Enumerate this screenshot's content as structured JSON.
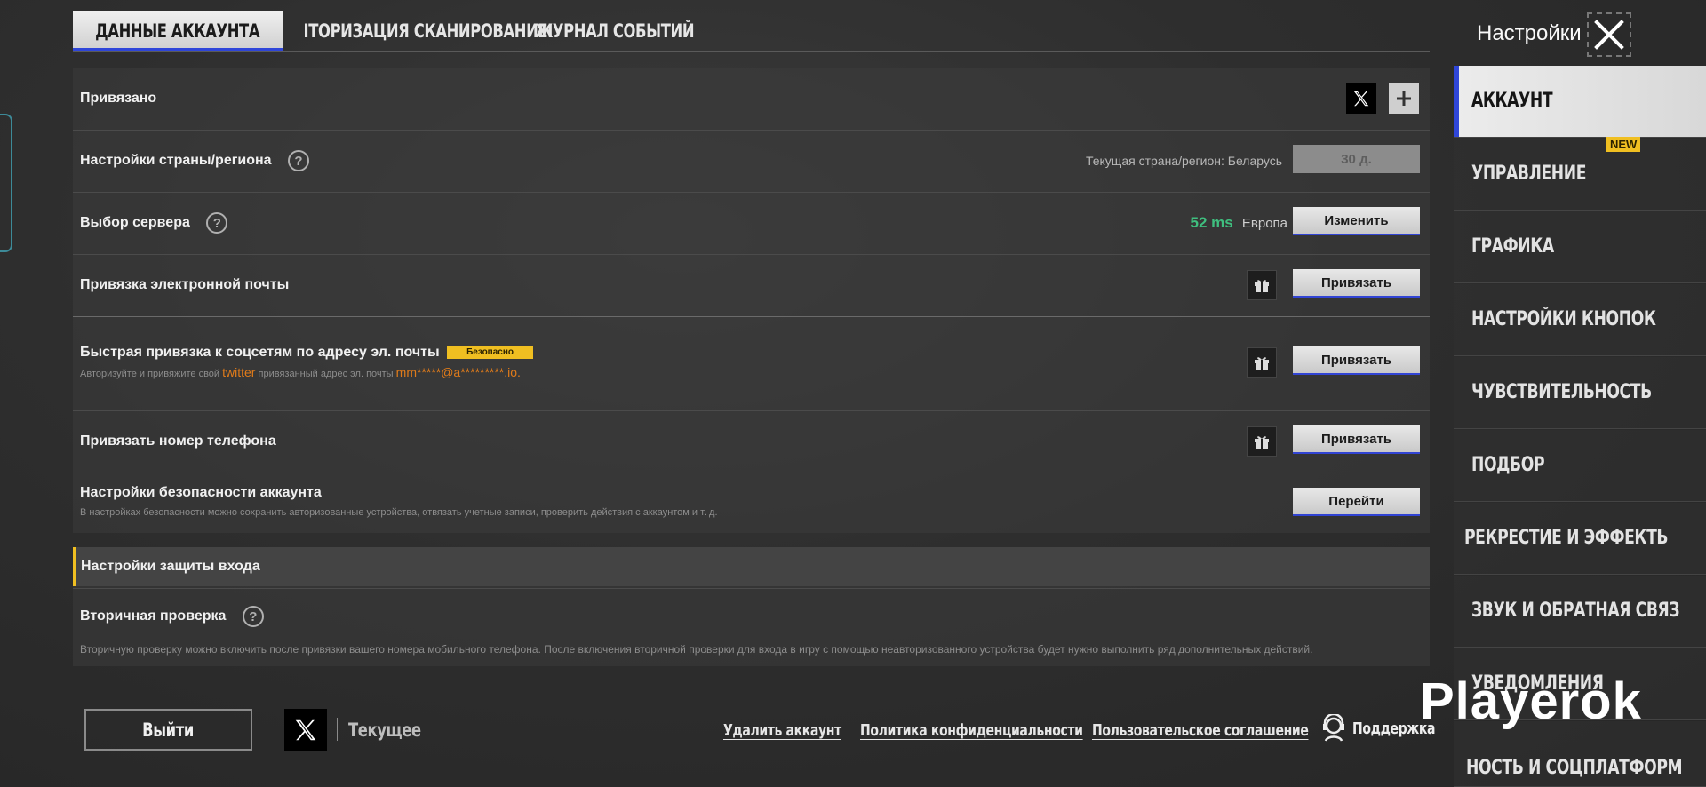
{
  "tabs": [
    {
      "label": "ДАННЫЕ АККАУНТА",
      "active": true
    },
    {
      "label": "ІТОРИЗАЦИЯ СКАНИРОВАНИЕІ",
      "active": false
    },
    {
      "label": "ЖУРНАЛ СОБЫТИЙ",
      "active": false
    }
  ],
  "rows": {
    "linked": {
      "label": "Привязано"
    },
    "region": {
      "label": "Настройки страны/региона",
      "current": "Текущая страна/регион: Беларусь",
      "button": "30 д."
    },
    "server": {
      "label": "Выбор сервера",
      "ping": "52 ms",
      "server_name": "Европа",
      "button": "Изменить"
    },
    "email": {
      "label": "Привязка электронной почты",
      "button": "Привязать"
    },
    "quick_bind": {
      "label": "Быстрая привязка к соцсетям по адресу эл. почты",
      "badge": "Безопасно",
      "sub_prefix": "Авторизуйте и привяжите свой",
      "sub_service": "twitter",
      "sub_middle": "привязанный адрес эл. почты",
      "sub_email": "mm*****@a*********.io.",
      "button": "Привязать"
    },
    "phone": {
      "label": "Привязать номер телефона",
      "button": "Привязать"
    },
    "security": {
      "label": "Настройки безопасности аккаунта",
      "sub": "В настройках безопасности можно сохранить авторизованные устройства, отвязать учетные записи, проверить действия с аккаунтом и т. д.",
      "button": "Перейти"
    }
  },
  "login_protection": {
    "title": "Настройки защиты входа",
    "secondary_label": "Вторичная проверка",
    "secondary_sub": "Вторичную проверку можно включить после привязки вашего номера мобильного телефона. После включения вторичной проверки для входа в игру с помощью неавторизованного устройства будет нужно выполнить ряд дополнительных действий."
  },
  "sidebar": {
    "title": "Настройки",
    "items": [
      {
        "label": "АККАУНТ",
        "active": true
      },
      {
        "label": "УПРАВЛЕНИЕ",
        "badge": "NEW"
      },
      {
        "label": "ГРАФИКА"
      },
      {
        "label": "НАСТРОЙКИ КНОПОК"
      },
      {
        "label": "ЧУВСТВИТЕЛЬНОСТЬ"
      },
      {
        "label": "ПОДБОР"
      },
      {
        "label": "РЕКРЕСТИЕ И ЭФФЕКТЬ"
      },
      {
        "label": "ЗВУК И ОБРАТНАЯ СВЯЗ"
      },
      {
        "label": "УВЕДОМЛЕНИЯ"
      },
      {
        "label": "НОСТЬ И СОЦПЛАТФОРМ"
      }
    ]
  },
  "footer": {
    "logout": "Выйти",
    "current": "Текущее",
    "delete_account": "Удалить аккаунт",
    "privacy": "Политика конфиденциальности",
    "terms": "Пользовательское соглашение",
    "support": "Поддержка"
  },
  "watermark": "Playerok",
  "colors": {
    "accent_blue": "#2f46d9",
    "ping_green": "#3fbf7f",
    "link_orange": "#e07b1a",
    "badge_yellow": "#f0bf21"
  }
}
